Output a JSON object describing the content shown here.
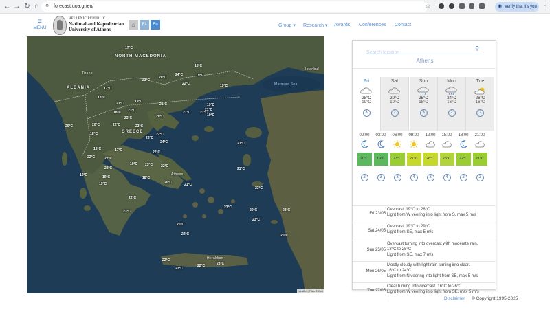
{
  "browser": {
    "url": "forecast.uoa.gr/en/",
    "verify_label": "Verify that it's you"
  },
  "header": {
    "menu_label": "MENU",
    "logo_line1": "HELLENIC REPUBLIC",
    "logo_line2": "National and Kapodistrian",
    "logo_line3": "University of Athens",
    "lang_el": "Ελ",
    "lang_en": "En",
    "nav": [
      {
        "label": "Group ▾"
      },
      {
        "label": "Research ▾"
      },
      {
        "label": "Awards"
      },
      {
        "label": "Conferences"
      },
      {
        "label": "Contact"
      }
    ]
  },
  "map": {
    "places": [
      "NORTH MACEDONIA",
      "ALBANIA",
      "GREECE",
      "Istanbul",
      "Marmara Sea",
      "Athens",
      "Heraklion",
      "Tirana"
    ],
    "temps": [
      "17°C",
      "24°C",
      "19°C",
      "18°C",
      "20°C",
      "17°C",
      "23°C",
      "22°C",
      "19°C",
      "18°C",
      "21°C",
      "19°C",
      "21°C",
      "18°C",
      "23°C",
      "19°C",
      "20°C",
      "21°C",
      "19°C",
      "23°C",
      "21°C",
      "20°C",
      "20°C",
      "22°C",
      "23°C",
      "18°C",
      "21°C",
      "22°C",
      "23°C",
      "17°C",
      "21°C",
      "19°C",
      "22°C",
      "22°C",
      "22°C",
      "21°C",
      "24°C",
      "19°C",
      "19°C",
      "22°C",
      "23°C",
      "19°C",
      "22°C",
      "20°C",
      "23°C",
      "22°C",
      "23°C",
      "23°C",
      "23°C",
      "22°C",
      "23°C",
      "20°C",
      "20°C",
      "22°C",
      "22°C",
      "23°C",
      "23°C",
      "20°C",
      "21°C",
      "18°C",
      "19°C"
    ],
    "attribution": "Leaflet | Tiles © Esri"
  },
  "forecast": {
    "search_placeholder": "Search location",
    "city": "Athens",
    "days": [
      {
        "name": "Fri",
        "max": "28°C",
        "min": "19°C",
        "wind": "3",
        "icon": "cloud-sun-icon"
      },
      {
        "name": "Sat",
        "max": "29°C",
        "min": "19°C",
        "wind": "2",
        "icon": "cloud-icon"
      },
      {
        "name": "Sun",
        "max": "25°C",
        "min": "18°C",
        "wind": "3",
        "icon": "cloud-rain-icon"
      },
      {
        "name": "Mon",
        "max": "24°C",
        "min": "16°C",
        "wind": "2",
        "icon": "cloud-rain-icon"
      },
      {
        "name": "Tue",
        "max": "26°C",
        "min": "16°C",
        "wind": "2",
        "icon": "sun-cloud-icon"
      }
    ],
    "hours": [
      {
        "time": "00:00",
        "temp": "20°C",
        "wind": "2",
        "icon": "moon-icon",
        "color": "#5cb85c"
      },
      {
        "time": "03:00",
        "temp": "19°C",
        "wind": "3",
        "icon": "moon-icon",
        "color": "#5cb85c"
      },
      {
        "time": "06:00",
        "temp": "23°C",
        "wind": "3",
        "icon": "sun-icon",
        "color": "#9acd32"
      },
      {
        "time": "09:00",
        "temp": "27°C",
        "wind": "4",
        "icon": "sun-icon",
        "color": "#c6d92a"
      },
      {
        "time": "12:00",
        "temp": "28°C",
        "wind": "3",
        "icon": "cloud-icon",
        "color": "#c6d92a"
      },
      {
        "time": "15:00",
        "temp": "25°C",
        "wind": "4",
        "icon": "cloud-icon",
        "color": "#b0d43a"
      },
      {
        "time": "18:00",
        "temp": "22°C",
        "wind": "2",
        "icon": "moon-icon",
        "color": "#9acd32"
      },
      {
        "time": "21:00",
        "temp": "21°C",
        "wind": "2",
        "icon": "cloud-icon",
        "color": "#9acd32"
      }
    ],
    "daily_text": [
      {
        "label": "Fri 23/05",
        "desc": "Overcast. 19°C to 28°C\nLight from W veering into light from S, max 5 m/s"
      },
      {
        "label": "Sat 24/05",
        "desc": "Overcast. 19°C to 29°C\nLight from SE, max 5 m/s"
      },
      {
        "label": "Sun 25/05",
        "desc": "Overcast turning into overcast with moderate rain.\n18°C to 25°C\nLight from SE, max 7 m/s"
      },
      {
        "label": "Mon 26/05",
        "desc": "Mostly cloudy with light rain turning into clear.\n16°C to 24°C\nLight from N veering into light from SE, max 5 m/s"
      },
      {
        "label": "Tue 27/05",
        "desc": "Clear turning into overcast. 16°C to 26°C\nLight from W veering into light from SE, max 5 m/s"
      }
    ]
  },
  "footer": {
    "disclaimer": "Disclaimer",
    "copyright": "© Copyright 1995-2025"
  },
  "colors": {
    "accent": "#4a8ad1",
    "link": "#5b8fd0",
    "sea": "#1e3c55",
    "land": "#4e5a3f"
  }
}
